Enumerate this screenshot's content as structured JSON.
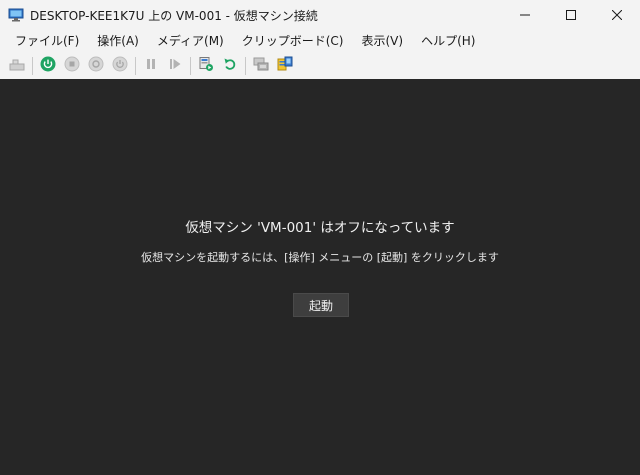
{
  "window": {
    "title": "DESKTOP-KEE1K7U 上の VM-001 - 仮想マシン接続",
    "app_icon": "vm-connect-icon"
  },
  "menu": {
    "items": [
      "ファイル(F)",
      "操作(A)",
      "メディア(M)",
      "クリップボード(C)",
      "表示(V)",
      "ヘルプ(H)"
    ]
  },
  "toolbar": {
    "buttons": [
      "ctrl-alt-del-icon",
      "power-start-icon",
      "turn-off-icon",
      "shutdown-icon",
      "save-state-icon",
      "pause-icon",
      "resume-icon",
      "checkpoint-icon",
      "revert-icon",
      "enhanced-session-icon",
      "share-icon"
    ]
  },
  "content": {
    "title": "仮想マシン 'VM-001' はオフになっています",
    "subtitle": "仮想マシンを起動するには、[操作] メニューの [起動] をクリックします",
    "start_button": "起動"
  },
  "colors": {
    "content_bg": "#262626",
    "chrome_bg": "#f3f3f3",
    "power_green": "#1fa463"
  }
}
